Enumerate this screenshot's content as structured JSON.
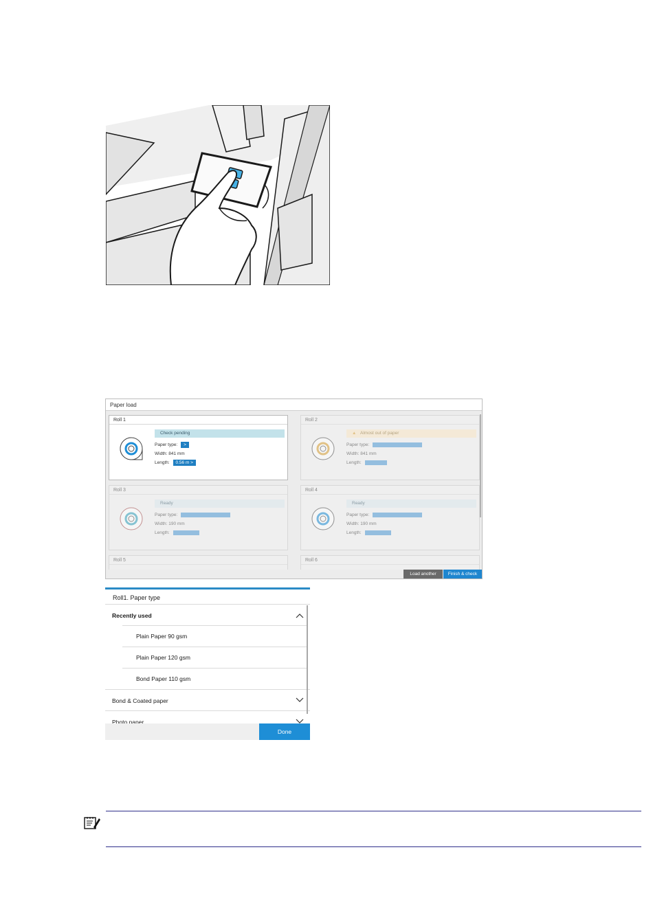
{
  "paper_load": {
    "title": "Paper load",
    "rolls": [
      {
        "title": "Roll 1",
        "status": "Check pending",
        "paper_type_label": "Paper type:",
        "paper_type_value": ">",
        "width_label": "Width:",
        "width_value": "841 mm",
        "length_label": "Length:",
        "length_value": "0.56 m  >"
      },
      {
        "title": "Roll 2",
        "status": "Almost out of paper",
        "paper_type_label": "Paper type:",
        "width_label": "Width:",
        "width_value": "841 mm",
        "length_label": "Length:"
      },
      {
        "title": "Roll 3",
        "status": "Ready",
        "paper_type_label": "Paper type:",
        "width_label": "Width:",
        "width_value": "190 mm",
        "length_label": "Length:"
      },
      {
        "title": "Roll 4",
        "status": "Ready",
        "paper_type_label": "Paper type:",
        "width_label": "Width:",
        "width_value": "190 mm",
        "length_label": "Length:"
      },
      {
        "title": "Roll 5"
      },
      {
        "title": "Roll 6"
      }
    ],
    "buttons": {
      "load_another": "Load another",
      "finish_check": "Finish & check"
    },
    "colors": {
      "accent": "#1f86cf",
      "pending": "#c3e2ea",
      "warning": "#fbe7c6"
    }
  },
  "paper_type_panel": {
    "title": "Roll1. Paper type",
    "recently_used_label": "Recently used",
    "recent_items": [
      "Plain Paper 90 gsm",
      "Plain Paper 120 gsm",
      "Bond Paper 110 gsm"
    ],
    "categories": [
      "Bond & Coated paper",
      "Photo paper"
    ],
    "done_label": "Done"
  },
  "note": {
    "icon": "note-icon"
  }
}
